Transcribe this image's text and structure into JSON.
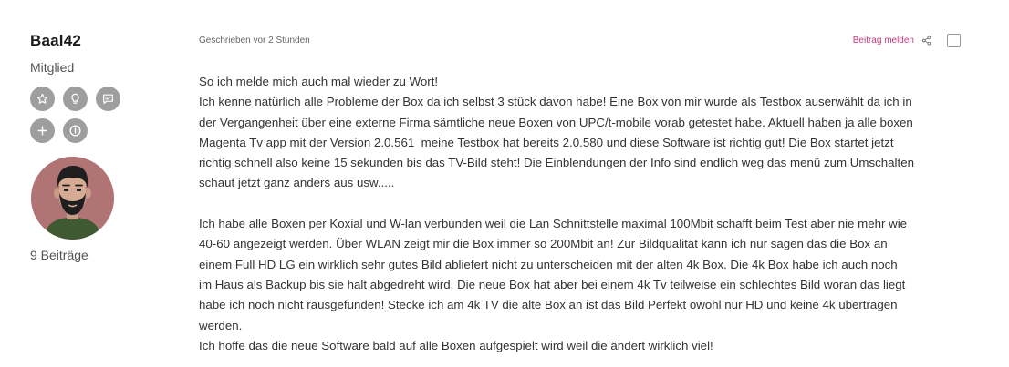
{
  "author": {
    "username": "Baal42",
    "rank": "Mitglied",
    "badges": [
      "star-icon",
      "lightbulb-icon",
      "chat-icon",
      "plus-icon",
      "info-icon"
    ],
    "avatar": "bearded-man-avatar",
    "post_count": "9 Beiträge"
  },
  "post": {
    "timestamp": "Geschrieben vor 2 Stunden",
    "report_label": "Beitrag melden",
    "share_icon": "share-icon",
    "lines_p1": [
      "So ich melde mich auch mal wieder zu Wort!",
      "Ich kenne natürlich alle Probleme der Box da ich selbst 3 stück davon habe! Eine Box von mir wurde als Testbox auserwählt da ich in",
      "der Vergangenheit über eine externe Firma sämtliche neue Boxen von UPC/t-mobile vorab getestet habe. Aktuell haben ja alle boxen",
      "Magenta Tv app mit der Version 2.0.561  meine Testbox hat bereits 2.0.580 und diese Software ist richtig gut! Die Box startet jetzt",
      "richtig schnell also keine 15 sekunden bis das TV-Bild steht! Die Einblendungen der Info sind endlich weg das menü zum Umschalten",
      "schaut jetzt ganz anders aus usw....."
    ],
    "lines_p2": [
      "Ich habe alle Boxen per Koxial und W-lan verbunden weil die Lan Schnittstelle maximal 100Mbit schafft beim Test aber nie mehr wie",
      "40-60 angezeigt werden. Über WLAN zeigt mir die Box immer so 200Mbit an! Zur Bildqualität kann ich nur sagen das die Box an",
      "einem Full HD LG ein wirklich sehr gutes Bild abliefert nicht zu unterscheiden mit der alten 4k Box. Die 4k Box habe ich auch noch",
      "im Haus als Backup bis sie halt abgedreht wird. Die neue Box hat aber bei einem 4k Tv teilweise ein schlechtes Bild woran das liegt",
      "habe ich noch nicht rausgefunden! Stecke ich am 4k TV die alte Box an ist das Bild Perfekt owohl nur HD und keine 4k übertragen",
      "werden.",
      "Ich hoffe das die neue Software bald auf alle Boxen aufgespielt wird weil die ändert wirklich viel!"
    ]
  },
  "colors": {
    "accent": "#c83b7c",
    "badge": "#9e9e9e",
    "avatar_bg": "#b07474"
  }
}
